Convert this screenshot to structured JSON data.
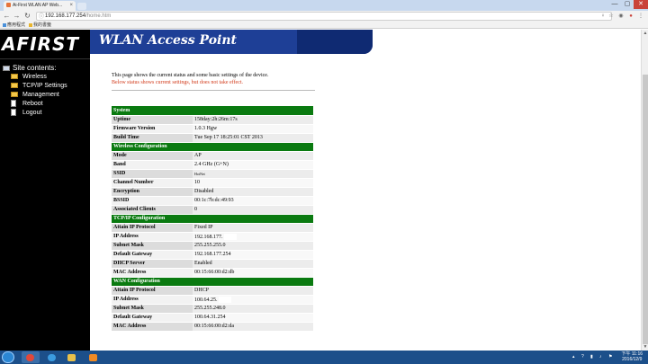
{
  "browser": {
    "tab_title": "Ai-First WLAN AP Web...",
    "address_host": "192.168.177.254",
    "address_path": "/home.htm",
    "bookmarks": [
      {
        "label": "應用程式",
        "color": "#4a90d9"
      },
      {
        "label": "我的書籤",
        "color": "#e8b52e"
      }
    ],
    "window_controls": [
      "—",
      "▢",
      "✕"
    ]
  },
  "sidebar": {
    "logo": "AFIRST",
    "heading": "Site contents:",
    "items": [
      {
        "label": "Wireless",
        "icon": "folder-icon"
      },
      {
        "label": "TCP/IP Settings",
        "icon": "folder-icon"
      },
      {
        "label": "Management",
        "icon": "folder-icon"
      },
      {
        "label": "Reboot",
        "icon": "document-icon"
      },
      {
        "label": "Logout",
        "icon": "document-icon"
      }
    ]
  },
  "banner": {
    "title": "WLAN Access Point"
  },
  "main": {
    "intro": "This page shows the current status and some basic settings of the device.",
    "warning": "Below status shows current settings, but does not take effect."
  },
  "status": {
    "system": {
      "title": "System",
      "rows": [
        {
          "label": "Uptime",
          "value": "158day:2h:26m:17s"
        },
        {
          "label": "Firmware Version",
          "value": "1.0.3 Hgw"
        },
        {
          "label": "Build Time",
          "value": "Tue Sep 17 18:25:01 CST 2013"
        }
      ]
    },
    "wireless": {
      "title": "Wireless Configuration",
      "rows": [
        {
          "label": "Mode",
          "value": "AP"
        },
        {
          "label": "Band",
          "value": "2.4 GHz (G+N)"
        },
        {
          "label": "SSID",
          "value": "HotNet"
        },
        {
          "label": "Channel Number",
          "value": "10"
        },
        {
          "label": "Encryption",
          "value": "Disabled"
        },
        {
          "label": "BSSID",
          "value": "00:1c:7b:dc:49:93"
        },
        {
          "label": "Associated Clients",
          "value": "0"
        }
      ]
    },
    "tcpip": {
      "title": "TCP/IP Configuration",
      "rows": [
        {
          "label": "Attain IP Protocol",
          "value": "Fixed IP"
        },
        {
          "label": "IP Address",
          "value": "192.168.177."
        },
        {
          "label": "Subnet Mask",
          "value": "255.255.255.0"
        },
        {
          "label": "Default Gateway",
          "value": "192.168.177.254"
        },
        {
          "label": "DHCP Server",
          "value": "Enabled"
        },
        {
          "label": "MAC Address",
          "value": "00:15:66:00:d2:db"
        }
      ]
    },
    "wan": {
      "title": "WAN Configuration",
      "rows": [
        {
          "label": "Attain IP Protocol",
          "value": "DHCP"
        },
        {
          "label": "IP Address",
          "value": "100.64.25."
        },
        {
          "label": "Subnet Mask",
          "value": "255.255.248.0"
        },
        {
          "label": "Default Gateway",
          "value": "100.64.31.254"
        },
        {
          "label": "MAC Address",
          "value": "00:15:66:00:d2:da"
        }
      ]
    }
  },
  "taskbar": {
    "time": "下午 11:16",
    "date": "2016/12/9"
  }
}
